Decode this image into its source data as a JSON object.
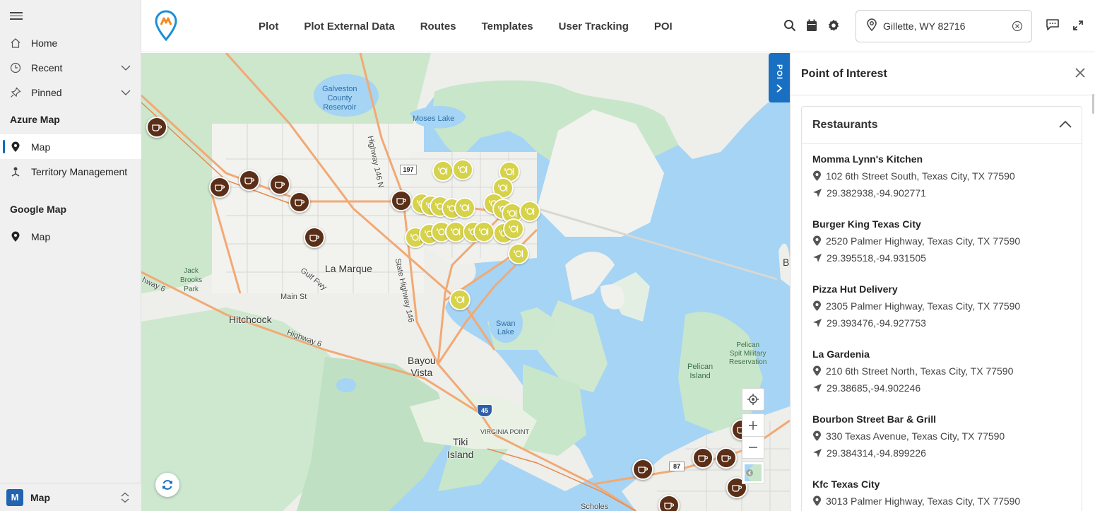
{
  "sidebar": {
    "items": [
      {
        "label": "Home",
        "icon": "home-icon"
      },
      {
        "label": "Recent",
        "icon": "clock-icon"
      },
      {
        "label": "Pinned",
        "icon": "pin-icon"
      }
    ],
    "azure_group": "Azure Map",
    "azure_items": [
      {
        "label": "Map",
        "icon": "map-pin-icon"
      },
      {
        "label": "Territory Management",
        "icon": "territory-icon"
      }
    ],
    "google_group": "Google Map",
    "google_items": [
      {
        "label": "Map",
        "icon": "map-pin-icon"
      }
    ],
    "footer": {
      "badge": "M",
      "label": "Map"
    }
  },
  "topbar": {
    "menu": [
      "Plot",
      "Plot External Data",
      "Routes",
      "Templates",
      "User Tracking",
      "POI"
    ],
    "location_value": "Gillette, WY 82716",
    "accent_color": "#1970c2"
  },
  "map": {
    "labels": {
      "la_marque": "La Marque",
      "hitchcock": "Hitchcock",
      "bayou_vista": "Bayou\nVista",
      "tiki_island": "Tiki\nIsland",
      "main_st": "Main St",
      "gulf_fwy": "Gulf Fwy",
      "highway6_a": "Highway 6",
      "highway6_b": "hway 6",
      "sh146": "State Highway 146",
      "h146n": "Highway 146 N",
      "virginia_point": "VIRGINIA POINT",
      "scholes": "Scholes",
      "moses_lake": "Moses Lake",
      "galveston_reservoir": "Galveston\nCounty\nReservoir",
      "swan_lake": "Swan\nLake",
      "jack_brooks": "Jack\nBrooks\nPark",
      "pelican_island": "Pelican\nIsland",
      "pelican_spit": "Pelican\nSpit Military\nReservation",
      "b_edge": "B",
      "shield_197": "197",
      "shield_45": "45",
      "shield_87": "87"
    },
    "poi_tab": "POI"
  },
  "poi_panel": {
    "title": "Point of Interest",
    "category": "Restaurants",
    "restaurants": [
      {
        "name": "Momma Lynn's Kitchen",
        "address": "102 6th Street South, Texas City, TX 77590",
        "coords": "29.382938,-94.902771"
      },
      {
        "name": "Burger King Texas City",
        "address": "2520 Palmer Highway, Texas City, TX 77590",
        "coords": "29.395518,-94.931505"
      },
      {
        "name": "Pizza Hut Delivery",
        "address": "2305 Palmer Highway, Texas City, TX 77590",
        "coords": "29.393476,-94.927753"
      },
      {
        "name": "La Gardenia",
        "address": "210 6th Street North, Texas City, TX 77590",
        "coords": "29.38685,-94.902246"
      },
      {
        "name": "Bourbon Street Bar & Grill",
        "address": "330 Texas Avenue, Texas City, TX 77590",
        "coords": "29.384314,-94.899226"
      },
      {
        "name": "Kfc Texas City",
        "address": "3013 Palmer Highway, Texas City, TX 77590",
        "coords": ""
      }
    ]
  }
}
